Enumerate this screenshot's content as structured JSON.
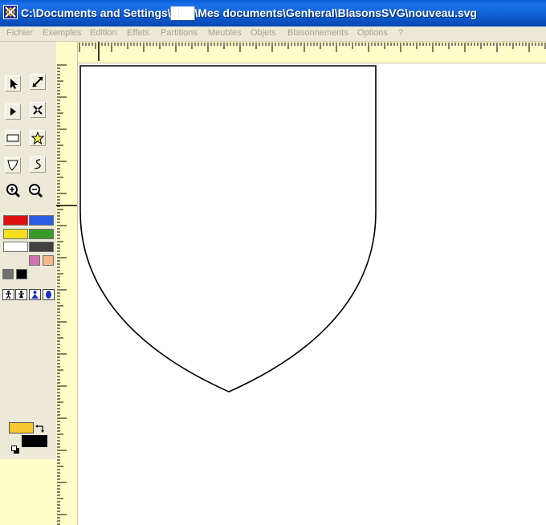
{
  "window": {
    "title": "C:\\Documents and Settings\\███\\Mes documents\\Genheral\\BlasonsSVG\\nouveau.svg"
  },
  "menu": [
    {
      "label": "Fichier"
    },
    {
      "label": "Exemples"
    },
    {
      "label": "Edition"
    },
    {
      "label": "Effets"
    },
    {
      "label": "Partitions"
    },
    {
      "label": "Meubles"
    },
    {
      "label": "Objets"
    },
    {
      "label": "Blasonnements"
    },
    {
      "label": "Options"
    },
    {
      "label": "?"
    }
  ],
  "tools": [
    {
      "icon": "arrow-select-icon"
    },
    {
      "icon": "resize-diagonal-icon"
    },
    {
      "icon": "node-select-icon"
    },
    {
      "icon": "transform-icon"
    },
    {
      "icon": "rectangle-icon"
    },
    {
      "icon": "star-icon"
    },
    {
      "icon": "polygon-icon"
    },
    {
      "icon": "freehand-icon"
    },
    {
      "icon": "zoom-in-icon"
    },
    {
      "icon": "zoom-out-icon"
    }
  ],
  "palette": {
    "colors": [
      "#e01010",
      "#2a5ee6",
      "#f4e020",
      "#3a9a2a",
      "#ffffff",
      "#404040",
      "#d070b0",
      "#f4b888",
      "#707070",
      "#000000"
    ]
  },
  "figures": [
    {
      "icon": "figure-man-icon"
    },
    {
      "icon": "figure-woman-icon"
    },
    {
      "icon": "figure-blue-person-icon"
    },
    {
      "icon": "figure-blue-drop-icon"
    }
  ],
  "current_colors": {
    "fill": "#f8c830",
    "stroke": "#000000",
    "swap_icon": "swap-arrows-icon",
    "reset_icon": "default-colors-icon"
  }
}
